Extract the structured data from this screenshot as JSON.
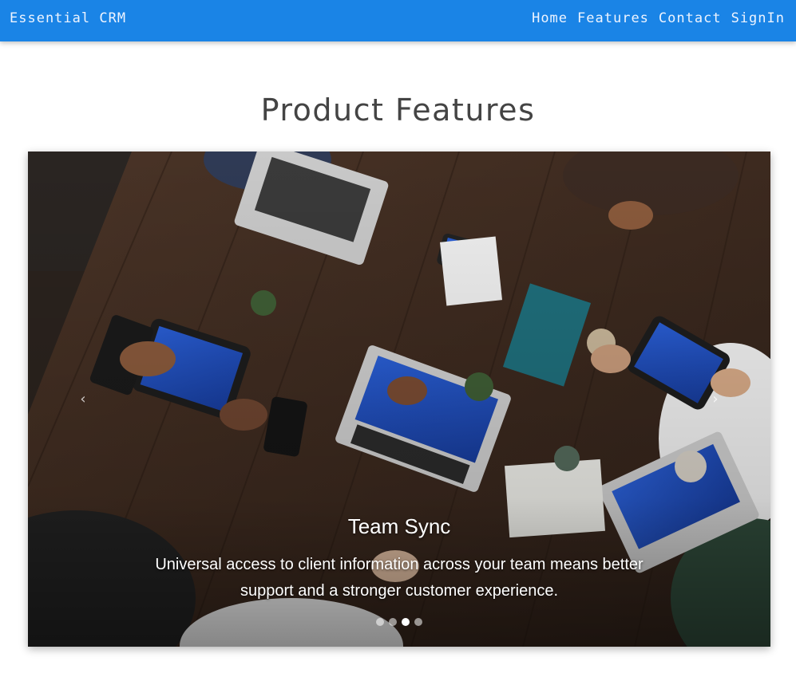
{
  "nav": {
    "brand": "Essential CRM",
    "links": [
      "Home",
      "Features",
      "Contact",
      "SignIn"
    ]
  },
  "main": {
    "title": "Product Features"
  },
  "carousel": {
    "caption_title": "Team Sync",
    "caption_text_line1": "Universal access to client information across your team means better",
    "caption_text_line2": "support and a stronger customer experience.",
    "slide_count": 4,
    "active_index": 2,
    "prev_icon": "chevron-left-icon",
    "next_icon": "chevron-right-icon"
  },
  "colors": {
    "navbar": "#1a84e6",
    "nav_text": "#eef4ff",
    "title": "#444444"
  }
}
